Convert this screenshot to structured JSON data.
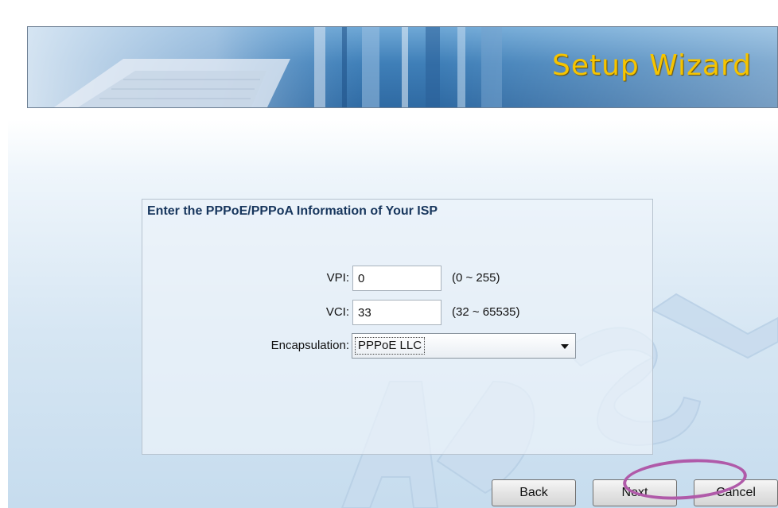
{
  "header": {
    "title": "Setup Wizard"
  },
  "form": {
    "heading": "Enter the PPPoE/PPPoA Information of Your ISP",
    "vpi": {
      "label": "VPI:",
      "value": "0",
      "range": "(0 ~ 255)"
    },
    "vci": {
      "label": "VCI:",
      "value": "33",
      "range": "(32 ~ 65535)"
    },
    "encapsulation": {
      "label": "Encapsulation:",
      "value": "PPPoE LLC"
    }
  },
  "buttons": {
    "back": "Back",
    "next": "Next",
    "cancel": "Cancel"
  },
  "watermark_text": "ADSL",
  "colors": {
    "title_yellow": "#f6c400",
    "heading_navy": "#17365d",
    "callout_purple": "#b05aa9"
  }
}
